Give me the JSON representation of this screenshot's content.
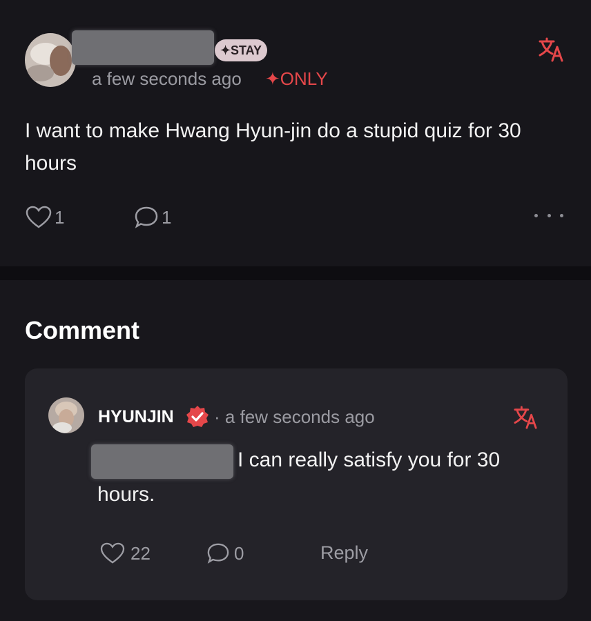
{
  "post": {
    "badge": "✦STAY",
    "time": "a few seconds ago",
    "only_tag": "✦ONLY",
    "text": "I want to make Hwang Hyun-jin do a stupid quiz for 30 hours",
    "like_count": "1",
    "comment_count": "1"
  },
  "comment_section": {
    "title": "Comment"
  },
  "comment": {
    "author": "HYUNJIN",
    "time": "· a few seconds ago",
    "text_line1": "I can really satisfy you for 30",
    "text_line2": "hours.",
    "like_count": "22",
    "comment_count": "0",
    "reply_label": "Reply"
  },
  "icons": {
    "translate": "translate-icon",
    "like": "heart-icon",
    "comment": "speech-bubble-icon",
    "more": "more-dots-icon",
    "verified": "verified-badge-icon"
  },
  "colors": {
    "background": "#17161b",
    "card": "#242329",
    "accent_red": "#e5474a",
    "muted_text": "#9b9ba2",
    "badge_bg": "#dcc9cf"
  }
}
